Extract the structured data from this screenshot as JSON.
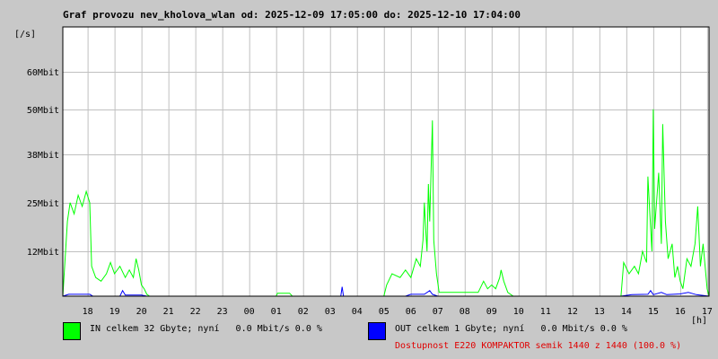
{
  "title": "Graf provozu nev_kholova_wlan od: 2025-12-09 17:05:00 do: 2025-12-10 17:04:00",
  "colors": {
    "background": "#c8c8c8",
    "plot_bg": "#ffffff",
    "grid": "#c0c0c0",
    "in": "#00ff00",
    "out": "#0000ff",
    "availability": "#e00000"
  },
  "legend": {
    "in_text": "IN celkem 32 Gbyte; nyní   0.0 Mbit/s 0.0 %",
    "out_text": "OUT celkem 1 Gbyte; nyní   0.0 Mbit/s 0.0 %",
    "availability_text": "Dostupnost E220 KOMPAKTOR semik 1440 z 1440 (100.0 %)"
  },
  "chart_data": {
    "type": "line",
    "title": "Graf provozu nev_kholova_wlan od: 2025-12-09 17:05:00 do: 2025-12-10 17:04:00",
    "ylabel": "[/s]",
    "xlabel": "[h]",
    "grid": true,
    "legend_position": "bottom",
    "ylim": [
      0,
      72
    ],
    "xlim": [
      17.08,
      41.07
    ],
    "y_ticks": [
      {
        "value": 12,
        "label": "12Mbit"
      },
      {
        "value": 25,
        "label": "25Mbit"
      },
      {
        "value": 38,
        "label": "38Mbit"
      },
      {
        "value": 50,
        "label": "50Mbit"
      },
      {
        "value": 60,
        "label": "60Mbit"
      }
    ],
    "x_ticks": [
      {
        "value": 18,
        "label": "18"
      },
      {
        "value": 19,
        "label": "19"
      },
      {
        "value": 20,
        "label": "20"
      },
      {
        "value": 21,
        "label": "21"
      },
      {
        "value": 22,
        "label": "22"
      },
      {
        "value": 23,
        "label": "23"
      },
      {
        "value": 24,
        "label": "00"
      },
      {
        "value": 25,
        "label": "01"
      },
      {
        "value": 26,
        "label": "02"
      },
      {
        "value": 27,
        "label": "03"
      },
      {
        "value": 28,
        "label": "04"
      },
      {
        "value": 29,
        "label": "05"
      },
      {
        "value": 30,
        "label": "06"
      },
      {
        "value": 31,
        "label": "07"
      },
      {
        "value": 32,
        "label": "08"
      },
      {
        "value": 33,
        "label": "09"
      },
      {
        "value": 34,
        "label": "10"
      },
      {
        "value": 35,
        "label": "11"
      },
      {
        "value": 36,
        "label": "12"
      },
      {
        "value": 37,
        "label": "13"
      },
      {
        "value": 38,
        "label": "14"
      },
      {
        "value": 39,
        "label": "15"
      },
      {
        "value": 40,
        "label": "16"
      },
      {
        "value": 41,
        "label": "17"
      }
    ],
    "series": [
      {
        "name": "IN",
        "color": "#00ff00",
        "points": [
          [
            17.08,
            0
          ],
          [
            17.25,
            20
          ],
          [
            17.35,
            25
          ],
          [
            17.5,
            22
          ],
          [
            17.65,
            27
          ],
          [
            17.8,
            24
          ],
          [
            17.95,
            28
          ],
          [
            18.08,
            25
          ],
          [
            18.15,
            8
          ],
          [
            18.3,
            5
          ],
          [
            18.5,
            4
          ],
          [
            18.7,
            6
          ],
          [
            18.85,
            9
          ],
          [
            19.0,
            6
          ],
          [
            19.2,
            8
          ],
          [
            19.4,
            5
          ],
          [
            19.55,
            7
          ],
          [
            19.7,
            5
          ],
          [
            19.8,
            10
          ],
          [
            19.9,
            7
          ],
          [
            20.0,
            3
          ],
          [
            20.1,
            2
          ],
          [
            20.2,
            0.5
          ],
          [
            20.3,
            0
          ],
          [
            25.0,
            0
          ],
          [
            25.05,
            0.8
          ],
          [
            25.5,
            0.8
          ],
          [
            25.6,
            0
          ],
          [
            29.0,
            0
          ],
          [
            29.1,
            3
          ],
          [
            29.3,
            6
          ],
          [
            29.6,
            5
          ],
          [
            29.8,
            7
          ],
          [
            30.0,
            5
          ],
          [
            30.2,
            10
          ],
          [
            30.35,
            8
          ],
          [
            30.45,
            15
          ],
          [
            30.5,
            25
          ],
          [
            30.55,
            18
          ],
          [
            30.6,
            12
          ],
          [
            30.65,
            30
          ],
          [
            30.7,
            20
          ],
          [
            30.8,
            47
          ],
          [
            30.85,
            15
          ],
          [
            30.95,
            6
          ],
          [
            31.05,
            1
          ],
          [
            31.5,
            1
          ],
          [
            32.0,
            1
          ],
          [
            32.5,
            1
          ],
          [
            32.7,
            4
          ],
          [
            32.85,
            2
          ],
          [
            33.0,
            3
          ],
          [
            33.15,
            2
          ],
          [
            33.3,
            5
          ],
          [
            33.35,
            7
          ],
          [
            33.45,
            4
          ],
          [
            33.6,
            1
          ],
          [
            33.8,
            0
          ],
          [
            37.8,
            0
          ],
          [
            37.9,
            9
          ],
          [
            38.1,
            6
          ],
          [
            38.3,
            8
          ],
          [
            38.45,
            6
          ],
          [
            38.6,
            12
          ],
          [
            38.75,
            9
          ],
          [
            38.8,
            32
          ],
          [
            38.85,
            25
          ],
          [
            38.95,
            12
          ],
          [
            39.0,
            50
          ],
          [
            39.05,
            18
          ],
          [
            39.2,
            33
          ],
          [
            39.3,
            14
          ],
          [
            39.35,
            46
          ],
          [
            39.45,
            20
          ],
          [
            39.55,
            10
          ],
          [
            39.7,
            14
          ],
          [
            39.8,
            5
          ],
          [
            39.9,
            8
          ],
          [
            40.0,
            4
          ],
          [
            40.1,
            2
          ],
          [
            40.25,
            10
          ],
          [
            40.4,
            8
          ],
          [
            40.55,
            14
          ],
          [
            40.65,
            24
          ],
          [
            40.75,
            8
          ],
          [
            40.85,
            14
          ],
          [
            41.0,
            2
          ],
          [
            41.07,
            0
          ]
        ]
      },
      {
        "name": "OUT",
        "color": "#0000ff",
        "points": [
          [
            17.08,
            0
          ],
          [
            17.3,
            0.5
          ],
          [
            17.5,
            0.5
          ],
          [
            17.8,
            0.5
          ],
          [
            18.08,
            0.5
          ],
          [
            18.2,
            0
          ],
          [
            19.2,
            0
          ],
          [
            19.3,
            1.5
          ],
          [
            19.4,
            0.3
          ],
          [
            19.6,
            0.3
          ],
          [
            20.0,
            0.3
          ],
          [
            20.2,
            0
          ],
          [
            27.4,
            0
          ],
          [
            27.45,
            2.5
          ],
          [
            27.5,
            0
          ],
          [
            29.8,
            0
          ],
          [
            30.0,
            0.5
          ],
          [
            30.5,
            0.5
          ],
          [
            30.7,
            1.5
          ],
          [
            30.8,
            0.5
          ],
          [
            31.0,
            0
          ],
          [
            37.8,
            0
          ],
          [
            38.2,
            0.4
          ],
          [
            38.8,
            0.5
          ],
          [
            38.9,
            1.5
          ],
          [
            39.0,
            0.4
          ],
          [
            39.3,
            1.0
          ],
          [
            39.5,
            0.4
          ],
          [
            40.0,
            0.6
          ],
          [
            40.3,
            1.0
          ],
          [
            40.6,
            0.4
          ],
          [
            41.07,
            0
          ]
        ]
      }
    ]
  }
}
